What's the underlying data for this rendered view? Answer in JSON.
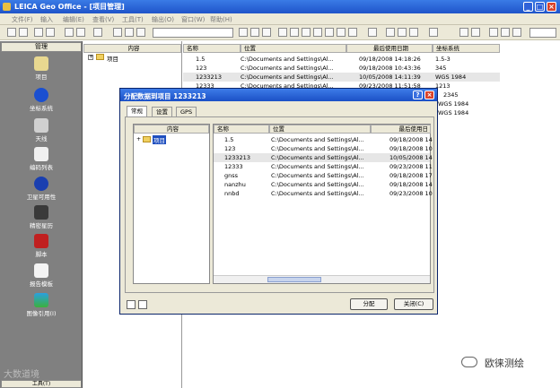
{
  "window": {
    "title": "LEICA Geo Office - [项目管理]"
  },
  "menu": [
    "文件(F)",
    "输入",
    "编辑(E)",
    "查看(V)",
    "工具(T)",
    "输出(O)",
    "窗口(W)",
    "帮助(H)"
  ],
  "sidebar": {
    "header": "管理",
    "items": [
      {
        "label": "项目",
        "icon": "project-icon"
      },
      {
        "label": "坐标系统",
        "icon": "globe-icon"
      },
      {
        "label": "天线",
        "icon": "antenna-icon"
      },
      {
        "label": "编码列表",
        "icon": "codelist-icon"
      },
      {
        "label": "卫星可用性",
        "icon": "satellite-icon"
      },
      {
        "label": "精密星历",
        "icon": "ephemeris-icon"
      },
      {
        "label": "脚本",
        "icon": "script-icon"
      },
      {
        "label": "报告模板",
        "icon": "report-icon"
      },
      {
        "label": "图像引用(I)",
        "icon": "image-icon"
      }
    ],
    "footer": "工具(T)"
  },
  "tree": {
    "header": "内容",
    "root": "项目"
  },
  "list": {
    "headers": [
      "名称",
      "位置",
      "最后使用日期",
      "坐标系统"
    ],
    "rows": [
      [
        "1.5",
        "C:\\Documents and Settings\\Al...",
        "09/18/2008 14:18:26",
        "1.5-3"
      ],
      [
        "123",
        "C:\\Documents and Settings\\Al...",
        "09/18/2008 10:43:36",
        "345"
      ],
      [
        "1233213",
        "C:\\Documents and Settings\\Al...",
        "10/05/2008 14:11:39",
        "WGS 1984"
      ],
      [
        "12333",
        "C:\\Documents and Settings\\Al...",
        "09/23/2008 11:51:58",
        "1213"
      ],
      [
        "",
        "",
        "",
        "2345"
      ],
      [
        "",
        "",
        "",
        "WGS 1984"
      ],
      [
        "",
        "",
        "",
        "WGS 1984"
      ]
    ]
  },
  "dialog": {
    "title": "分配数据到项目 1233213",
    "tabs": [
      "常规",
      "设置",
      "GPS"
    ],
    "tree_header": "内容",
    "tree_root": "项目",
    "headers": [
      "名称",
      "位置",
      "最后使用日"
    ],
    "rows": [
      [
        "1.5",
        "C:\\Documents and Settings\\Al...",
        "09/18/2008 14"
      ],
      [
        "123",
        "C:\\Documents and Settings\\Al...",
        "09/18/2008 10"
      ],
      [
        "1233213",
        "C:\\Documents and Settings\\Al...",
        "10/05/2008 14"
      ],
      [
        "12333",
        "C:\\Documents and Settings\\Al...",
        "09/23/2008 11"
      ],
      [
        "gnss",
        "C:\\Documents and Settings\\Al...",
        "09/18/2008 17"
      ],
      [
        "nanzhu",
        "C:\\Documents and Settings\\Al...",
        "09/18/2008 14"
      ],
      [
        "nnbd",
        "C:\\Documents and Settings\\Al...",
        "09/23/2008 10"
      ]
    ],
    "assign_label": "分配",
    "close_label": "关闭(C)"
  },
  "watermarks": {
    "left": "大数道境",
    "right": "欧徕测绘"
  }
}
